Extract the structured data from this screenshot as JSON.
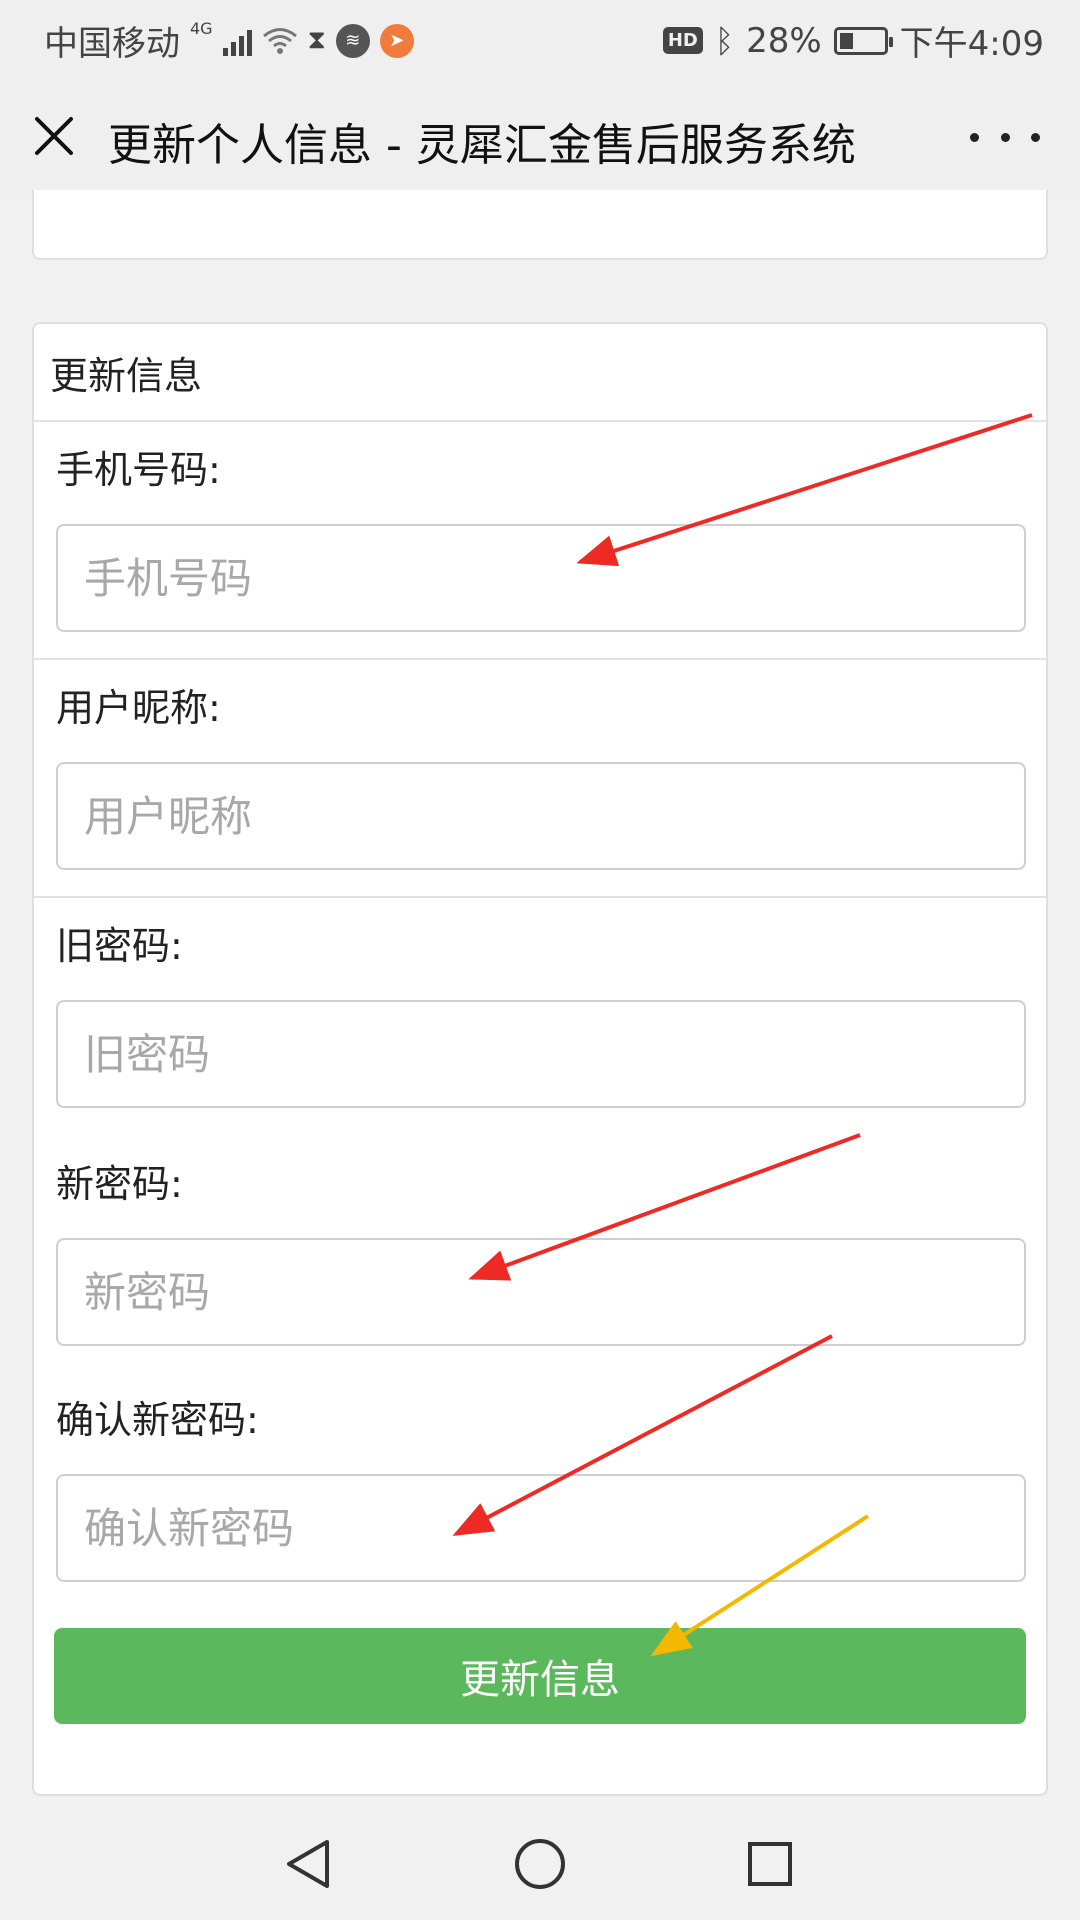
{
  "status_bar": {
    "carrier": "中国移动",
    "network": "4G",
    "battery": "28%",
    "time": "下午4:09",
    "hd_label": "HD"
  },
  "title_bar": {
    "title": "更新个人信息 - 灵犀汇金售后服务系统",
    "close_icon": "close-icon",
    "more_icon": "more-icon"
  },
  "form": {
    "header": "更新信息",
    "fields": [
      {
        "label": "手机号码:",
        "placeholder": "手机号码",
        "value": ""
      },
      {
        "label": "用户昵称:",
        "placeholder": "用户昵称",
        "value": ""
      },
      {
        "label": "旧密码:",
        "placeholder": "旧密码",
        "value": ""
      },
      {
        "label": "新密码:",
        "placeholder": "新密码",
        "value": ""
      },
      {
        "label": "确认新密码:",
        "placeholder": "确认新密码",
        "value": ""
      }
    ],
    "submit_label": "更新信息"
  },
  "colors": {
    "submit_bg": "#5cb85c",
    "annotation_red": "#ee2a24",
    "annotation_yellow": "#f5b800"
  },
  "nav_bar": {
    "icons": [
      "back-triangle-icon",
      "home-circle-icon",
      "recents-square-icon"
    ]
  }
}
